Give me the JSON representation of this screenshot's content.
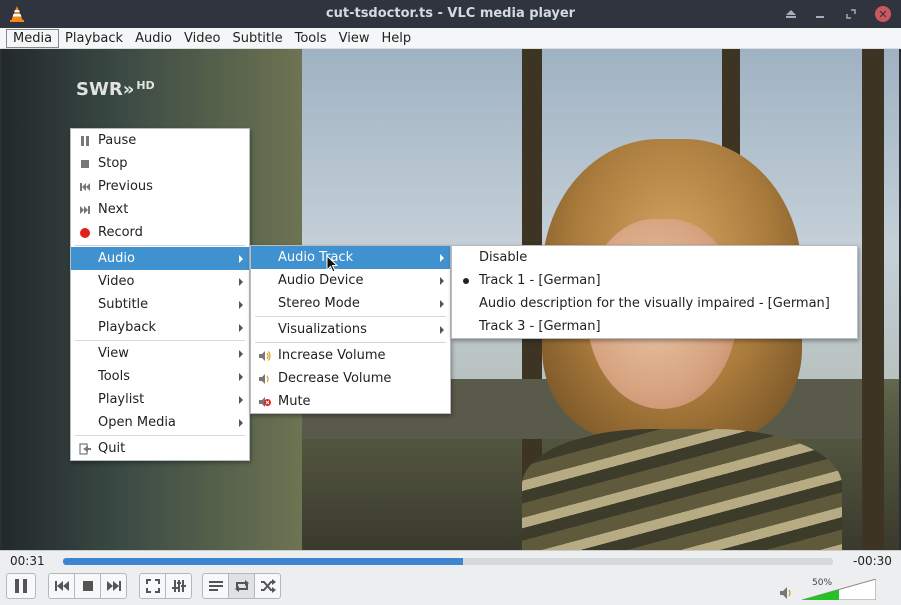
{
  "window": {
    "title": "cut-tsdoctor.ts - VLC media player",
    "buttons": [
      "minimize",
      "restore",
      "maximize",
      "close"
    ]
  },
  "menubar": {
    "items": [
      "Media",
      "Playback",
      "Audio",
      "Video",
      "Subtitle",
      "Tools",
      "View",
      "Help"
    ]
  },
  "video": {
    "watermark": "SWR",
    "watermark_suffix": "HD"
  },
  "context_menu": {
    "items": [
      {
        "label": "Pause",
        "icon": "pause-icon"
      },
      {
        "label": "Stop",
        "icon": "stop-icon"
      },
      {
        "label": "Previous",
        "icon": "previous-icon"
      },
      {
        "label": "Next",
        "icon": "next-icon"
      },
      {
        "label": "Record",
        "icon": "record-icon"
      },
      {
        "label": "Audio",
        "submenu": true,
        "active": true
      },
      {
        "label": "Video",
        "submenu": true
      },
      {
        "label": "Subtitle",
        "submenu": true
      },
      {
        "label": "Playback",
        "submenu": true
      },
      {
        "label": "View",
        "submenu": true
      },
      {
        "label": "Tools",
        "submenu": true
      },
      {
        "label": "Playlist",
        "submenu": true
      },
      {
        "label": "Open Media",
        "submenu": true
      },
      {
        "label": "Quit",
        "icon": "quit-icon"
      }
    ]
  },
  "audio_menu": {
    "items": [
      {
        "label": "Audio Track",
        "submenu": true,
        "active": true
      },
      {
        "label": "Audio Device",
        "submenu": true
      },
      {
        "label": "Stereo Mode",
        "submenu": true
      },
      {
        "label": "Visualizations",
        "submenu": true
      },
      {
        "label": "Increase Volume",
        "icon": "volume-up-icon"
      },
      {
        "label": "Decrease Volume",
        "icon": "volume-down-icon"
      },
      {
        "label": "Mute",
        "icon": "mute-icon"
      }
    ]
  },
  "audio_track_menu": {
    "items": [
      {
        "label": "Disable",
        "selected": false
      },
      {
        "label": "Track 1 - [German]",
        "selected": true
      },
      {
        "label": "Audio description for the visually impaired - [German]",
        "selected": false
      },
      {
        "label": "Track 3 - [German]",
        "selected": false
      }
    ]
  },
  "controls": {
    "elapsed": "00:31",
    "remaining": "-00:30",
    "progress": 0.52,
    "volume_label": "50%",
    "volume": 0.5
  },
  "colors": {
    "accent": "#3f91cf",
    "record": "#e0201b",
    "titlebar": "#2f343f",
    "close": "#cc575d",
    "volume_fill": "#27c027"
  }
}
